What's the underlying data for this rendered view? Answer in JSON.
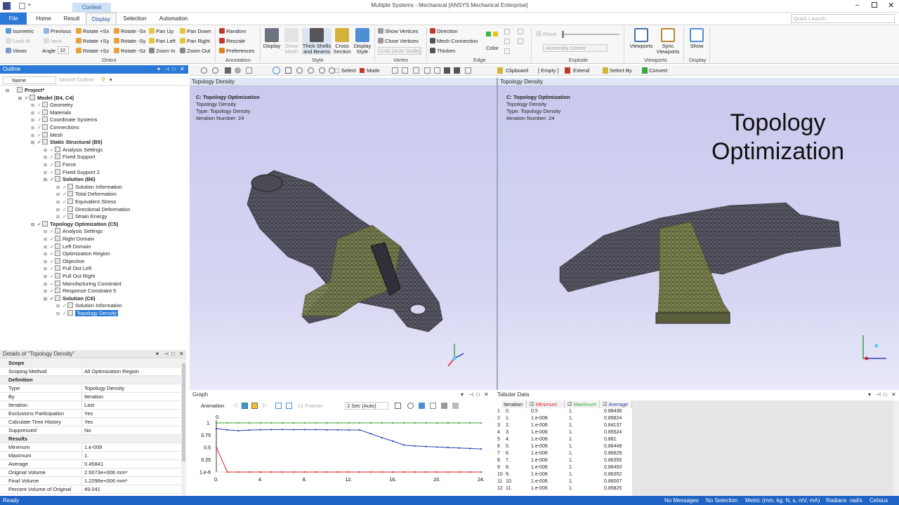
{
  "window": {
    "title": "Multiple Systems - Mechanical [ANSYS Mechanical Enterprise]",
    "context_tab": "Context"
  },
  "tabs": [
    {
      "label": "File"
    },
    {
      "label": "Home"
    },
    {
      "label": "Result"
    },
    {
      "label": "Display"
    },
    {
      "label": "Selection"
    },
    {
      "label": "Automation"
    }
  ],
  "quick_launch": {
    "placeholder": "Quick Launch"
  },
  "ribbon": {
    "orient": {
      "isometric": "Isometric",
      "previous": "Previous",
      "next": "Next",
      "look_at": "Look At",
      "views": "Views",
      "angle_label": "Angle",
      "angle_value": "10",
      "rot_px": "Rotate +Sx",
      "rot_mx": "Rotate -Sx",
      "rot_py": "Rotate +Sy",
      "rot_my": "Rotate -Sy",
      "rot_pz": "Rotate +Sz",
      "rot_mz": "Rotate -Sz",
      "pan_up": "Pan Up",
      "pan_down": "Pan Down",
      "pan_left": "Pan Left",
      "pan_right": "Pan Right",
      "zoom_in": "Zoom In",
      "zoom_out": "Zoom Out",
      "group": "Orient"
    },
    "annotation": {
      "random": "Random",
      "rescale": "Rescale",
      "preferences": "Preferences",
      "group": "Annotation"
    },
    "style": {
      "display": "Display",
      "show_mesh": "Show Mesh",
      "thick": "Thick Shells and Beams",
      "cross": "Cross Section",
      "display_style": "Display Style",
      "group": "Style"
    },
    "vertex": {
      "show": "Show Vertices",
      "close": "Close Vertices",
      "auto": "0.42 (Auto Scale)",
      "group": "Vertex"
    },
    "edge": {
      "direction": "Direction",
      "mesh_conn": "Mesh Connection",
      "thicken": "Thicken",
      "color": "Color",
      "group": "Edge"
    },
    "explode": {
      "reset": "Reset",
      "assembly": "Assembly Center",
      "group": "Explode"
    },
    "viewports": {
      "viewports": "Viewports",
      "sync": "Sync Viewports",
      "group": "Viewports"
    },
    "display": {
      "show": "Show",
      "group": "Display"
    }
  },
  "outline": {
    "title": "Outline",
    "name_col": "Name",
    "search_placeholder": "Search Outline",
    "tree": [
      {
        "label": "Project*",
        "depth": 0,
        "bold": true
      },
      {
        "label": "Model (B4, C4)",
        "depth": 1,
        "bold": true
      },
      {
        "label": "Geometry",
        "depth": 2
      },
      {
        "label": "Materials",
        "depth": 2
      },
      {
        "label": "Coordinate Systems",
        "depth": 2
      },
      {
        "label": "Connections",
        "depth": 2
      },
      {
        "label": "Mesh",
        "depth": 2
      },
      {
        "label": "Static Structural (B5)",
        "depth": 2,
        "bold": true
      },
      {
        "label": "Analysis Settings",
        "depth": 3
      },
      {
        "label": "Fixed Support",
        "depth": 3
      },
      {
        "label": "Force",
        "depth": 3
      },
      {
        "label": "Fixed Support 2",
        "depth": 3
      },
      {
        "label": "Solution (B6)",
        "depth": 3,
        "bold": true
      },
      {
        "label": "Solution Information",
        "depth": 4
      },
      {
        "label": "Total Deformation",
        "depth": 4
      },
      {
        "label": "Equivalent Stress",
        "depth": 4
      },
      {
        "label": "Directional Deformation",
        "depth": 4
      },
      {
        "label": "Strain Energy",
        "depth": 4
      },
      {
        "label": "Topology Optimization (C5)",
        "depth": 2,
        "bold": true
      },
      {
        "label": "Analysis Settings",
        "depth": 3
      },
      {
        "label": "Right Domain",
        "depth": 3
      },
      {
        "label": "Left Domain",
        "depth": 3
      },
      {
        "label": "Optimization Region",
        "depth": 3
      },
      {
        "label": "Objective",
        "depth": 3
      },
      {
        "label": "Pull Out Left",
        "depth": 3
      },
      {
        "label": "Pull Out Right",
        "depth": 3
      },
      {
        "label": "Manufacturing Constraint",
        "depth": 3
      },
      {
        "label": "Response Constraint 5",
        "depth": 3
      },
      {
        "label": "Solution (C6)",
        "depth": 3,
        "bold": true
      },
      {
        "label": "Solution Information",
        "depth": 4
      },
      {
        "label": "Topology Density",
        "depth": 4,
        "selected": true
      }
    ]
  },
  "details": {
    "title": "Details of \"Topology Density\"",
    "rows": [
      {
        "k": "Scope",
        "section": true
      },
      {
        "k": "Scoping Method",
        "v": "All Optimization Region"
      },
      {
        "k": "Definition",
        "section": true
      },
      {
        "k": "Type",
        "v": "Topology Density"
      },
      {
        "k": "By",
        "v": "Iteration"
      },
      {
        "k": "Iteration",
        "v": "Last"
      },
      {
        "k": "Exclusions Participation",
        "v": "Yes"
      },
      {
        "k": "Calculate Time History",
        "v": "Yes"
      },
      {
        "k": "Suppressed",
        "v": "No"
      },
      {
        "k": "Results",
        "section": true
      },
      {
        "k": "Minimum",
        "v": "1.e-006"
      },
      {
        "k": "Maximum",
        "v": "1."
      },
      {
        "k": "Average",
        "v": "0.45841"
      },
      {
        "k": "Original Volume",
        "v": "2.5073e+006 mm³"
      },
      {
        "k": "Final Volume",
        "v": "1.2296e+006 mm³"
      },
      {
        "k": "Percent Volume of Original",
        "v": "49.041"
      }
    ]
  },
  "toolbar": {
    "select": "Select",
    "mode": "Mode",
    "clipboard": "Clipboard",
    "empty": "[ Empty ]",
    "extend": "Extend",
    "select_by": "Select By",
    "convert": "Convert"
  },
  "view_left": {
    "header": "Topology Density",
    "title": "C: Topology Optimization",
    "line1": "Topology Density",
    "line2": "Type: Topology Density",
    "line3": "Iteration Number: 24"
  },
  "view_right": {
    "header": "Topology Density",
    "title": "C: Topology Optimization",
    "line1": "Topology Density",
    "line2": "Type: Topology Density",
    "line3": "Iteration Number: 24",
    "big_title": "Topology Optimization"
  },
  "graph": {
    "title": "Graph",
    "animation": "Animation",
    "frames": "21 Frames",
    "speed": "2 Sec (Auto)"
  },
  "chart_data": {
    "type": "line",
    "x": [
      0,
      1,
      2,
      3,
      4,
      5,
      6,
      7,
      8,
      9,
      10,
      11,
      12,
      13,
      14,
      15,
      16,
      17,
      18,
      19,
      20,
      21,
      22,
      23,
      24
    ],
    "xticks": [
      "0.",
      "4.",
      "8.",
      "12.",
      "16.",
      "20.",
      "24."
    ],
    "yticks": [
      "1.",
      "0.75",
      "0.5",
      "0.25",
      "1.e-6"
    ],
    "top_label": "0.",
    "series": [
      {
        "name": "Minimum",
        "color": "#d9262c",
        "values": [
          0.5,
          1e-06,
          1e-06,
          1e-06,
          1e-06,
          1e-06,
          1e-06,
          1e-06,
          1e-06,
          1e-06,
          1e-06,
          1e-06,
          1e-06,
          1e-06,
          1e-06,
          1e-06,
          1e-06,
          1e-06,
          1e-06,
          1e-06,
          1e-06,
          1e-06,
          1e-06,
          1e-06,
          1e-06
        ]
      },
      {
        "name": "Maximum",
        "color": "#3aa63a",
        "values": [
          1,
          1,
          1,
          1,
          1,
          1,
          1,
          1,
          1,
          1,
          1,
          1,
          1,
          1,
          1,
          1,
          1,
          1,
          1,
          1,
          1,
          1,
          1,
          1,
          1
        ]
      },
      {
        "name": "Average",
        "color": "#2b3fb5",
        "values": [
          0.88436,
          0.85824,
          0.84137,
          0.85524,
          0.861,
          0.86449,
          0.86629,
          0.86355,
          0.86493,
          0.86352,
          0.86007,
          0.85825,
          0.858,
          0.857,
          0.78,
          0.7,
          0.63,
          0.55,
          0.53,
          0.52,
          0.51,
          0.5,
          0.49,
          0.48,
          0.47
        ]
      }
    ],
    "ylim": [
      0,
      1
    ],
    "xlim": [
      0,
      24
    ]
  },
  "tabular": {
    "title": "Tabular Data",
    "columns": [
      "Iteration",
      "Minimum",
      "Maximum",
      "Average"
    ],
    "rows": [
      [
        "1",
        "0.",
        "0.5",
        "1.",
        "0.88436"
      ],
      [
        "2",
        "1.",
        "1.e-006",
        "1.",
        "0.85824"
      ],
      [
        "3",
        "2.",
        "1.e-006",
        "1.",
        "0.84137"
      ],
      [
        "4",
        "3.",
        "1.e-006",
        "1.",
        "0.85524"
      ],
      [
        "5",
        "4.",
        "1.e-006",
        "1.",
        "0.861"
      ],
      [
        "6",
        "5.",
        "1.e-006",
        "1.",
        "0.86449"
      ],
      [
        "7",
        "6.",
        "1.e-006",
        "1.",
        "0.86629"
      ],
      [
        "8",
        "7.",
        "1.e-006",
        "1.",
        "0.86355"
      ],
      [
        "9",
        "8.",
        "1.e-006",
        "1.",
        "0.86493"
      ],
      [
        "10",
        "9.",
        "1.e-006",
        "1.",
        "0.86352"
      ],
      [
        "11",
        "10.",
        "1.e-006",
        "1.",
        "0.86007"
      ],
      [
        "12",
        "11.",
        "1.e-006",
        "1.",
        "0.85825"
      ]
    ]
  },
  "status": {
    "ready": "Ready",
    "messages": "No Messages",
    "selection": "No Selection",
    "units": "Metric (mm, kg, N, s, mV, mA)",
    "angle": "Radians",
    "rate": "rad/s",
    "temp": "Celsius"
  },
  "colors": {
    "accent": "#2b79d6",
    "status_bar": "#1f63c4",
    "view_bg": "#cfcff0"
  }
}
